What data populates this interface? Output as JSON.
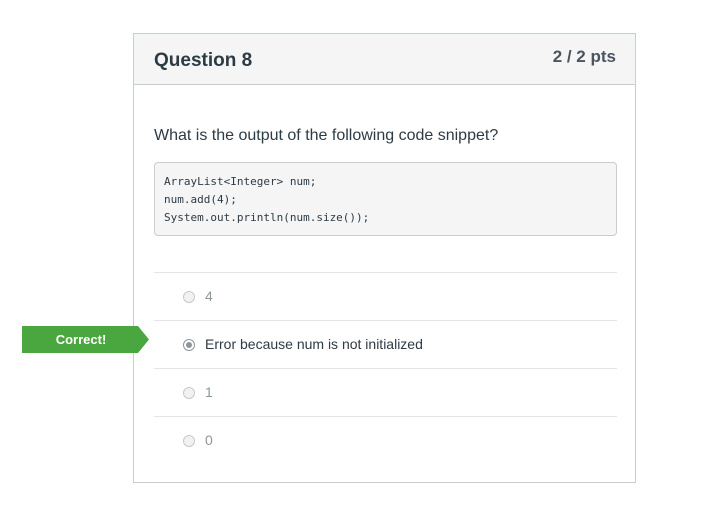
{
  "question": {
    "title": "Question 8",
    "points": "2 / 2 pts",
    "prompt": "What is the output of the following code snippet?",
    "code_lines": [
      "ArrayList<Integer> num;",
      "num.add(4);",
      "System.out.println(num.size());"
    ],
    "answers": [
      {
        "label": "4",
        "selected": false
      },
      {
        "label": "Error because num is not initialized",
        "selected": true
      },
      {
        "label": "1",
        "selected": false
      },
      {
        "label": "0",
        "selected": false
      }
    ]
  },
  "feedback": {
    "correct_label": "Correct!",
    "color": "#4aa63f"
  },
  "colors": {
    "header_bg": "#f5f5f5",
    "border": "#c7cdd1",
    "text": "#2d3b45",
    "muted_text": "#8b969e"
  }
}
